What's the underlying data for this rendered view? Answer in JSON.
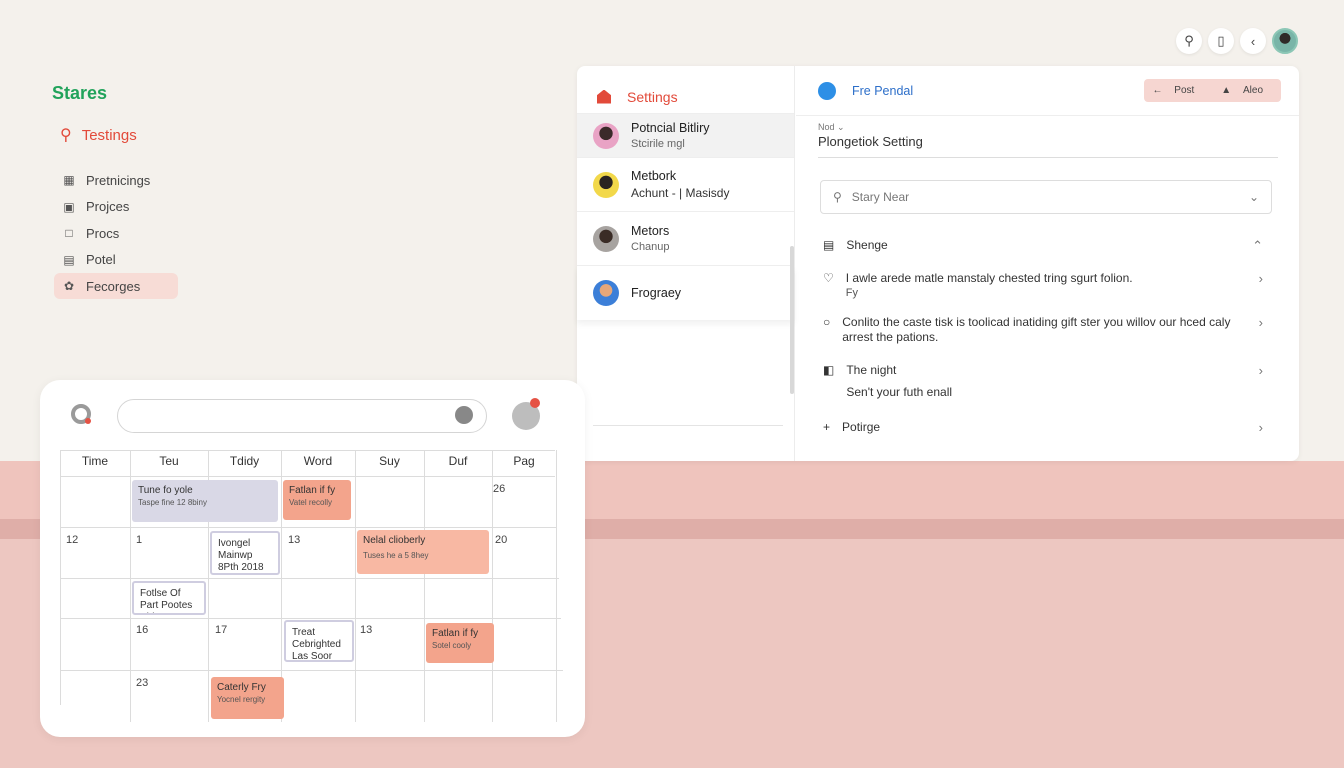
{
  "colors": {
    "brand": "#21a35b",
    "accent": "#e24a3a",
    "link": "#2d6fc9",
    "active_nav": "#f7dcd6"
  },
  "topbar": {
    "icons": [
      "search-icon",
      "clipboard-icon",
      "back-icon",
      "avatar"
    ]
  },
  "sidebar": {
    "brand": "Stares",
    "title": "Testings",
    "items": [
      {
        "label": "Pretnicings",
        "icon": "building-icon"
      },
      {
        "label": "Projces",
        "icon": "edit-icon"
      },
      {
        "label": "Procs",
        "icon": "note-icon"
      },
      {
        "label": "Potel",
        "icon": "table-icon"
      },
      {
        "label": "Fecorges",
        "icon": "palette-icon",
        "active": true
      }
    ]
  },
  "settings": {
    "title": "Settings",
    "people": [
      {
        "name": "Potncial Bitliry",
        "sub": "Stcirile mgl"
      },
      {
        "name": "Metbork",
        "sub": "Achunt - | Masisdy"
      },
      {
        "name": "Metors",
        "sub": "Chanup"
      },
      {
        "name": "Frograey",
        "sub": ""
      }
    ],
    "detail": {
      "title": "Fre Pendal",
      "pill_left": "Post",
      "pill_right": "Aleo",
      "field_hint": "Nod ⌄",
      "field_value": "Plongetiok Setting",
      "search_placeholder": "Stary Near",
      "rows": [
        {
          "icon": "link-icon",
          "text": "Shenge",
          "sub": "",
          "arrow": "⌃"
        },
        {
          "icon": "heart-icon",
          "text": "I awle arede matle manstaly chested tring sgurt folion.",
          "sub": "Fy",
          "arrow": "›"
        },
        {
          "icon": "circle-icon",
          "text": "Conlito the caste tisk is toolicad inatiding gift ster you willov our hced caly arrest the pations.",
          "sub": "",
          "arrow": "›"
        },
        {
          "icon": "image-icon",
          "text": "The night",
          "sub": "Sen't your futh enall",
          "arrow": "›"
        },
        {
          "icon": "plus-icon",
          "text": "Potirge",
          "sub": "",
          "arrow": "›"
        }
      ]
    }
  },
  "calendar": {
    "headers": [
      "Time",
      "Teu",
      "Tdidy",
      "Word",
      "Suy",
      "Duf",
      "Pag"
    ],
    "day_numbers": [
      {
        "label": "26",
        "col": 6,
        "row": 0
      },
      {
        "label": "12",
        "col": 0,
        "row": 1
      },
      {
        "label": "1",
        "col": 1,
        "row": 1
      },
      {
        "label": "13",
        "col": 3,
        "row": 1
      },
      {
        "label": "20",
        "col": 6,
        "row": 1
      },
      {
        "label": "16",
        "col": 1,
        "row": 3
      },
      {
        "label": "17",
        "col": 2,
        "row": 3
      },
      {
        "label": "13",
        "col": 4,
        "row": 3
      },
      {
        "label": "23",
        "col": 1,
        "row": 4
      }
    ],
    "events": [
      {
        "title": "Tune fo yole",
        "sub": "Taspe fine 12 8biny"
      },
      {
        "title": "Fatlan if fy",
        "sub": "Vatel recolly"
      },
      {
        "title": "Ivongel Mainwp 8Pth 2018",
        "sub": ""
      },
      {
        "title": "Nelal clioberly",
        "sub": "Tuses he a 5 8hey"
      },
      {
        "title": "Fotlse Of Part Pootes Shite",
        "sub": ""
      },
      {
        "title": "Treat Cebrighted Las Soor",
        "sub": ""
      },
      {
        "title": "Fatlan if fy",
        "sub": "Sotel cooly"
      },
      {
        "title": "Caterly Fry",
        "sub": "Yocnel rergity"
      }
    ]
  }
}
